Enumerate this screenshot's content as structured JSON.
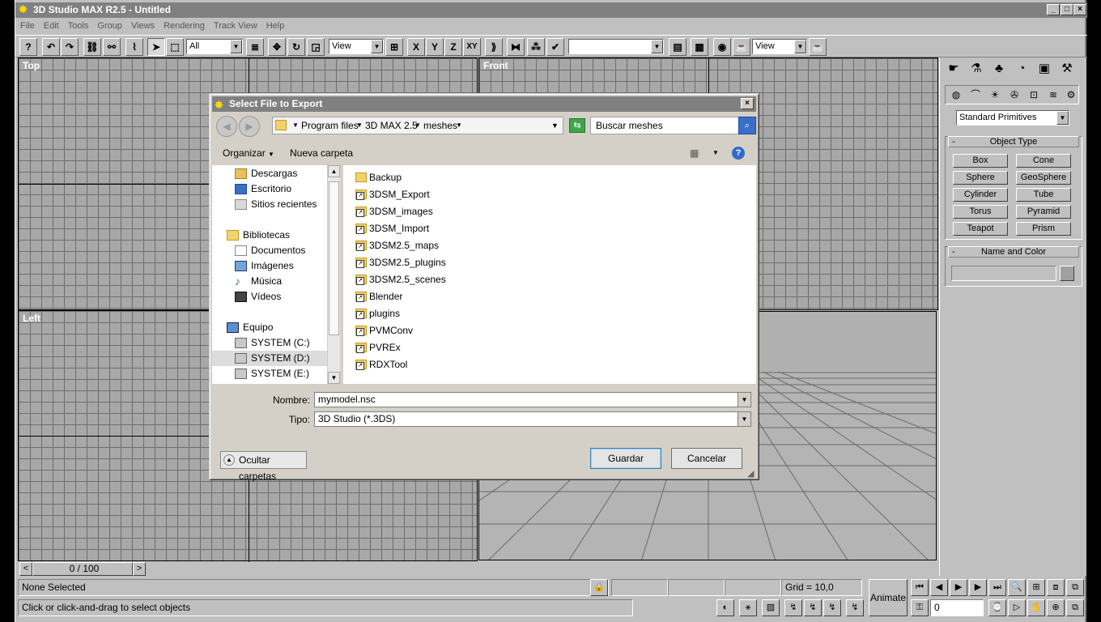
{
  "app": {
    "title": "3D Studio MAX R2.5 - Untitled",
    "menu": [
      "File",
      "Edit",
      "Tools",
      "Group",
      "Views",
      "Rendering",
      "Track View",
      "Help"
    ],
    "toolbar": {
      "selection_filter": "All",
      "ref_coord": "View",
      "named_selection": "",
      "view_combo": "View",
      "axis_x": "X",
      "axis_y": "Y",
      "axis_z": "Z",
      "axis_xy": "XY"
    },
    "viewports": {
      "top": "Top",
      "front": "Front",
      "left": "Left"
    },
    "time_slider": "0 / 100",
    "command_panel": {
      "category": "Standard Primitives",
      "object_type_title": "Object Type",
      "buttons": [
        "Box",
        "Cone",
        "Sphere",
        "GeoSphere",
        "Cylinder",
        "Tube",
        "Torus",
        "Pyramid",
        "Teapot",
        "Prism"
      ],
      "name_color_title": "Name and Color",
      "rollout_minus": "-"
    },
    "status": {
      "selection": "None Selected",
      "prompt": "Click or click-and-drag to select objects",
      "grid": "Grid = 10,0",
      "animate": "Animate",
      "frame": "0"
    }
  },
  "dialog": {
    "title": "Select File to Export",
    "breadcrumb": [
      "Program files",
      "3D MAX 2.5",
      "meshes"
    ],
    "search_placeholder": "Buscar meshes",
    "organize": "Organizar",
    "new_folder": "Nueva carpeta",
    "nav": [
      {
        "label": "Descargas",
        "icon": "folder-icon"
      },
      {
        "label": "Escritorio",
        "icon": "desktop-icon"
      },
      {
        "label": "Sitios recientes",
        "icon": "recent-icon"
      },
      {
        "label": "Bibliotecas",
        "icon": "library-icon"
      },
      {
        "label": "Documentos",
        "icon": "document-icon"
      },
      {
        "label": "Imágenes",
        "icon": "image-icon"
      },
      {
        "label": "Música",
        "icon": "music-icon"
      },
      {
        "label": "Vídeos",
        "icon": "video-icon"
      },
      {
        "label": "Equipo",
        "icon": "computer-icon"
      },
      {
        "label": "SYSTEM (C:)",
        "icon": "drive-icon"
      },
      {
        "label": "SYSTEM (D:)",
        "icon": "drive-icon"
      },
      {
        "label": "SYSTEM (E:)",
        "icon": "drive-icon"
      }
    ],
    "files": [
      {
        "name": "Backup",
        "shortcut": false
      },
      {
        "name": "3DSM_Export",
        "shortcut": true
      },
      {
        "name": "3DSM_images",
        "shortcut": true
      },
      {
        "name": "3DSM_Import",
        "shortcut": true
      },
      {
        "name": "3DSM2.5_maps",
        "shortcut": true
      },
      {
        "name": "3DSM2.5_plugins",
        "shortcut": true
      },
      {
        "name": "3DSM2.5_scenes",
        "shortcut": true
      },
      {
        "name": "Blender",
        "shortcut": true
      },
      {
        "name": "plugins",
        "shortcut": true
      },
      {
        "name": "PVMConv",
        "shortcut": true
      },
      {
        "name": "PVREx",
        "shortcut": true
      },
      {
        "name": "RDXTool",
        "shortcut": true
      }
    ],
    "filename_label": "Nombre:",
    "filename_value": "mymodel.nsc",
    "type_label": "Tipo:",
    "type_value": "3D Studio (*.3DS)",
    "hide_folders": "Ocultar carpetas",
    "save": "Guardar",
    "cancel": "Cancelar"
  },
  "colors": {
    "titlebar": "#808080",
    "viewport_grid": "#a8a8a8",
    "search_button": "#3a6fc4"
  }
}
